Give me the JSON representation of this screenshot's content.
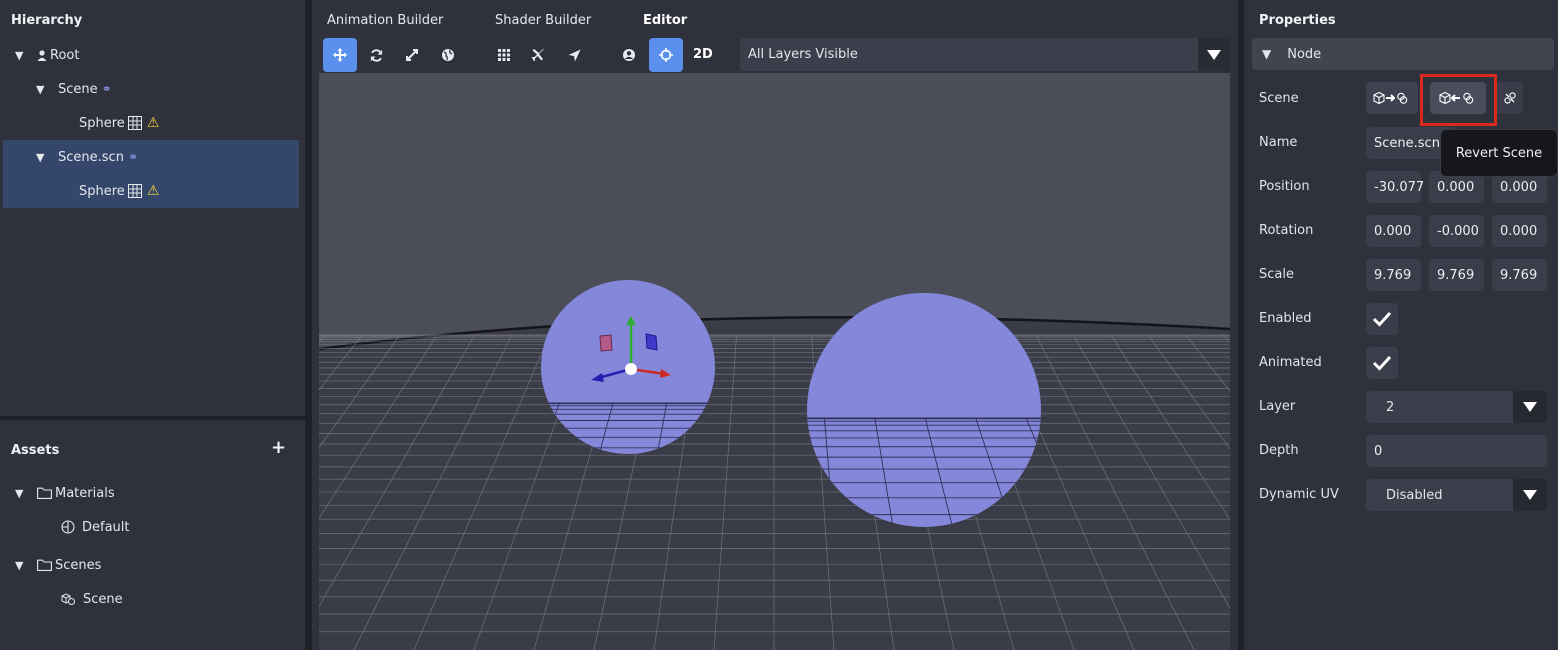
{
  "hierarchy": {
    "title": "Hierarchy",
    "items": [
      {
        "label": "Root",
        "depth": 0,
        "icon": "user-icon"
      },
      {
        "label": "Scene",
        "depth": 1,
        "icon": "link-icon"
      },
      {
        "label": "Sphere",
        "depth": 2,
        "icon": "mesh-icon",
        "warning": true
      },
      {
        "label": "Scene.scn",
        "depth": 1,
        "icon": "link-icon",
        "selected": true
      },
      {
        "label": "Sphere",
        "depth": 2,
        "icon": "mesh-icon",
        "warning": true,
        "selected": true
      }
    ]
  },
  "assets": {
    "title": "Assets",
    "add_label": "+",
    "items": [
      {
        "label": "Materials",
        "type": "folder"
      },
      {
        "label": "Default",
        "type": "material"
      },
      {
        "label": "Scenes",
        "type": "folder"
      },
      {
        "label": "Scene",
        "type": "scene"
      }
    ]
  },
  "editor": {
    "tabs": [
      "Animation Builder",
      "Shader Builder",
      "Editor"
    ],
    "active_tab": "Editor",
    "mode_label": "2D",
    "layers_select": "All Layers Visible"
  },
  "properties": {
    "title": "Properties",
    "section": "Node",
    "scene_label": "Scene",
    "name_label": "Name",
    "name_value": "Scene.scn",
    "position_label": "Position",
    "position": [
      "-30.077",
      "0.000",
      "0.000"
    ],
    "rotation_label": "Rotation",
    "rotation": [
      "0.000",
      "-0.000",
      "0.000"
    ],
    "scale_label": "Scale",
    "scale": [
      "9.769",
      "9.769",
      "9.769"
    ],
    "enabled_label": "Enabled",
    "animated_label": "Animated",
    "layer_label": "Layer",
    "layer_value": "2",
    "depth_label": "Depth",
    "depth_value": "0",
    "dynamic_uv_label": "Dynamic UV",
    "dynamic_uv_value": "Disabled",
    "tooltip": "Revert Scene"
  },
  "colors": {
    "accent": "#5a8fee",
    "sphere": "#8587da",
    "highlight": "#d9291f",
    "warning": "#f2d330"
  }
}
